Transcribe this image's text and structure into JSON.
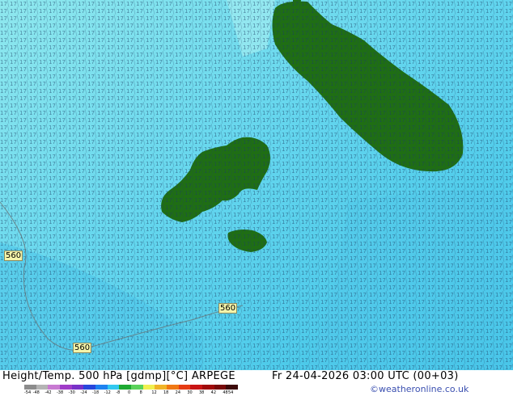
{
  "map": {
    "land_color": "#1f6e14",
    "sea_colors": [
      "#8fe8ee",
      "#64d6ee",
      "#3ec3e8"
    ],
    "contour_labels": [
      "560",
      "560",
      "560"
    ]
  },
  "footer": {
    "title": "Height/Temp. 500 hPa [gdmp][°C] ARPEGE",
    "valid_time": "Fr 24-04-2026 03:00 UTC (00+03)",
    "credit": "©weatheronline.co.uk"
  },
  "scale": {
    "ticks": [
      "-54",
      "-48",
      "-42",
      "-38",
      "-30",
      "-24",
      "-18",
      "-12",
      "-8",
      "0",
      "8",
      "12",
      "18",
      "24",
      "30",
      "38",
      "42",
      "48",
      "54"
    ],
    "colors": [
      "#8c8c8c",
      "#b4b4b4",
      "#c87ad2",
      "#a03cc8",
      "#7832c8",
      "#2846dc",
      "#1e82f0",
      "#32c8f0",
      "#1eaa32",
      "#5ad25a",
      "#f0f050",
      "#f0b428",
      "#f07814",
      "#e63c14",
      "#c81414",
      "#a00a0a",
      "#780a0a",
      "#3c0a0a"
    ]
  }
}
